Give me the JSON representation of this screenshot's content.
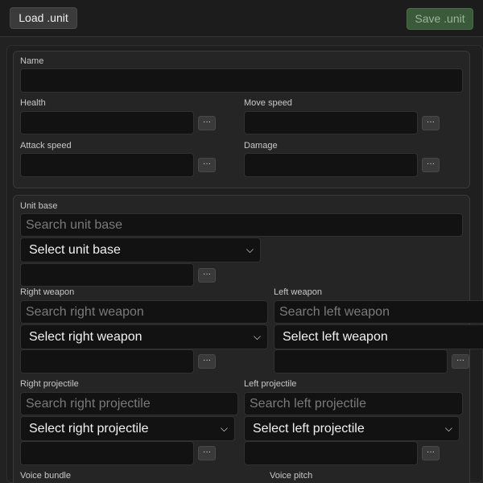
{
  "toolbar": {
    "load_label": "Load .unit",
    "save_label": "Save .unit"
  },
  "stats": {
    "name_label": "Name",
    "health_label": "Health",
    "move_speed_label": "Move speed",
    "attack_speed_label": "Attack speed",
    "damage_label": "Damage",
    "more_label": "···"
  },
  "parts": {
    "unit_base": {
      "label": "Unit base",
      "search_placeholder": "Search unit base",
      "select_value": "Select unit base"
    },
    "right_weapon": {
      "label": "Right weapon",
      "search_placeholder": "Search right weapon",
      "select_value": "Select right weapon"
    },
    "left_weapon": {
      "label": "Left weapon",
      "search_placeholder": "Search left weapon",
      "select_value": "Select left weapon"
    },
    "right_projectile": {
      "label": "Right projectile",
      "search_placeholder": "Search right projectile",
      "select_value": "Select right projectile"
    },
    "left_projectile": {
      "label": "Left projectile",
      "search_placeholder": "Search left projectile",
      "select_value": "Select left projectile"
    },
    "voice_bundle_label": "Voice bundle",
    "voice_pitch_label": "Voice pitch"
  },
  "icons": {
    "chevron": "chevron-down-icon"
  }
}
